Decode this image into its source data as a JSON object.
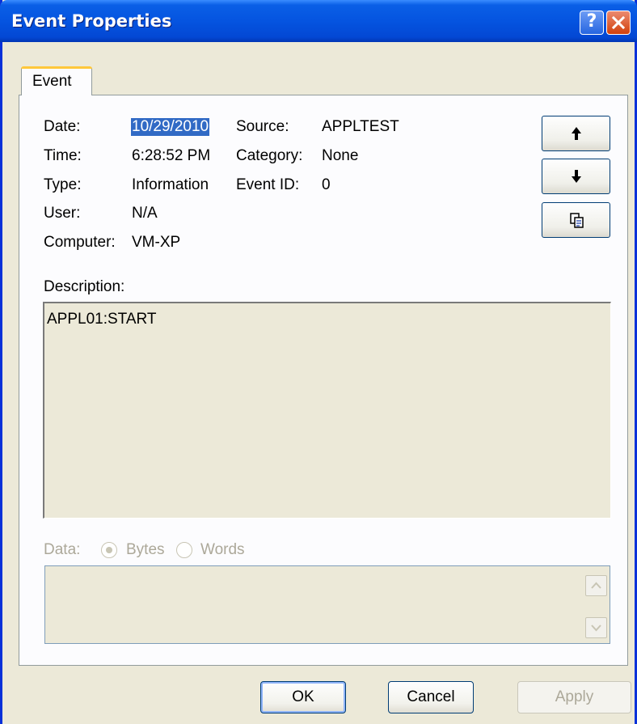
{
  "window": {
    "title": "Event Properties",
    "help_glyph": "?"
  },
  "tabs": [
    {
      "label": "Event",
      "active": true
    }
  ],
  "event": {
    "date_label": "Date:",
    "date_value": "10/29/2010",
    "time_label": "Time:",
    "time_value": "6:28:52 PM",
    "type_label": "Type:",
    "type_value": "Information",
    "user_label": "User:",
    "user_value": "N/A",
    "computer_label": "Computer:",
    "computer_value": "VM-XP",
    "source_label": "Source:",
    "source_value": "APPLTEST",
    "category_label": "Category:",
    "category_value": "None",
    "event_id_label": "Event ID:",
    "event_id_value": "0"
  },
  "nav_buttons": [
    {
      "icon": "arrow-up-icon"
    },
    {
      "icon": "arrow-down-icon"
    },
    {
      "icon": "copy-icon"
    }
  ],
  "description": {
    "label": "Description:",
    "text": "APPL01:START"
  },
  "data_section": {
    "label": "Data:",
    "options": [
      "Bytes",
      "Words"
    ],
    "selected": "Bytes",
    "enabled": false
  },
  "buttons": {
    "ok": "OK",
    "cancel": "Cancel",
    "apply": "Apply"
  },
  "colors": {
    "titlebar": "#0554e0",
    "selection": "#316ac5",
    "dialog_bg": "#ece9d8",
    "tab_accent": "#ffc83c"
  }
}
